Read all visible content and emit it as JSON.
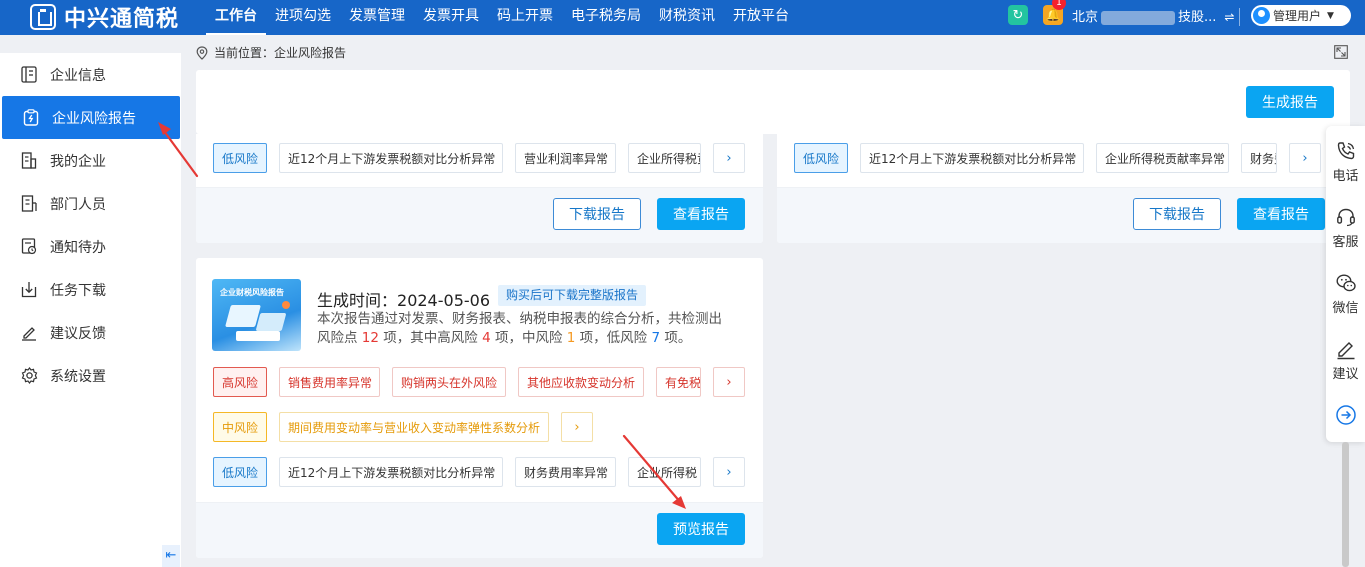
{
  "topbar": {
    "brand": "中兴通简税",
    "nav": [
      "工作台",
      "进项勾选",
      "发票管理",
      "发票开具",
      "码上开票",
      "电子税务局",
      "财税资讯",
      "开放平台"
    ],
    "active_nav": "工作台",
    "notification_count": "1",
    "company_prefix": "北京",
    "company_hidden": "",
    "company_suffix": "技股...",
    "switch_icon": "⇌",
    "user": "管理用户"
  },
  "sidebar": {
    "items": [
      {
        "label": "企业信息",
        "icon": "building-icon"
      },
      {
        "label": "企业风险报告",
        "icon": "risk-report-icon",
        "active": true
      },
      {
        "label": "我的企业",
        "icon": "company-icon"
      },
      {
        "label": "部门人员",
        "icon": "department-icon"
      },
      {
        "label": "通知待办",
        "icon": "todo-icon"
      },
      {
        "label": "任务下载",
        "icon": "download-icon"
      },
      {
        "label": "建议反馈",
        "icon": "feedback-icon"
      },
      {
        "label": "系统设置",
        "icon": "settings-icon"
      }
    ]
  },
  "breadcrumb": {
    "label": "当前位置：",
    "current": "企业风险报告"
  },
  "actions": {
    "generate": "生成报告"
  },
  "card_left_top": {
    "level": "低风险",
    "tags": [
      "近12个月上下游发票税额对比分析异常",
      "营业利润率异常",
      "企业所得税贡"
    ],
    "download": "下载报告",
    "view": "查看报告"
  },
  "card_right_top": {
    "level": "低风险",
    "tags": [
      "近12个月上下游发票税额对比分析异常",
      "企业所得税贡献率异常",
      "财务费"
    ],
    "download": "下载报告",
    "view": "查看报告"
  },
  "card_bottom": {
    "thumb_title": "企业财税风险报告",
    "gen_label": "生成时间：",
    "gen_time": "2024-05-06",
    "buy_tag": "购买后可下载完整版报告",
    "summary_1": "本次报告通过对发票、财务报表、纳税申报表的综合分析，共检测出",
    "summary_2": "风险点",
    "total": "12",
    "summary_3": "项，其中高风险",
    "high_count": "4",
    "summary_4": "项，中风险",
    "mid_count": "1",
    "summary_5": "项，低风险",
    "low_count": "7",
    "summary_6": "项。",
    "high": {
      "level": "高风险",
      "tags": [
        "销售费用率异常",
        "购销两头在外风险",
        "其他应收款变动分析",
        "有免税"
      ]
    },
    "mid": {
      "level": "中风险",
      "tags": [
        "期间费用变动率与营业收入变动率弹性系数分析"
      ]
    },
    "low": {
      "level": "低风险",
      "tags": [
        "近12个月上下游发票税额对比分析异常",
        "财务费用率异常",
        "企业所得税"
      ]
    },
    "preview": "预览报告"
  },
  "float_panel": {
    "phone": "电话",
    "service": "客服",
    "wechat": "微信",
    "suggest": "建议"
  },
  "colors": {
    "topbar": "#1766c8",
    "primary": "#0aa5f2",
    "active": "#1677e6",
    "high": "#d6342b",
    "mid": "#e59b0a",
    "low": "#1677c8",
    "arrow": "#e53935"
  }
}
